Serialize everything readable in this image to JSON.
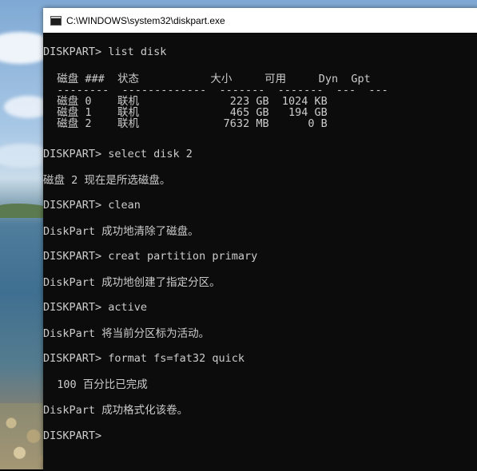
{
  "window": {
    "title": "C:\\WINDOWS\\system32\\diskpart.exe"
  },
  "console": {
    "lines": [
      "DISKPART> list disk",
      "  磁盘 ###  状态           大小     可用     Dyn  Gpt",
      "  --------  -------------  -------  -------  ---  ---",
      "  磁盘 0    联机              223 GB  1024 KB",
      "  磁盘 1    联机              465 GB   194 GB",
      "  磁盘 2    联机             7632 MB      0 B",
      "DISKPART> select disk 2",
      "磁盘 2 现在是所选磁盘。",
      "DISKPART> clean",
      "DiskPart 成功地清除了磁盘。",
      "DISKPART> creat partition primary",
      "DiskPart 成功地创建了指定分区。",
      "DISKPART> active",
      "DiskPart 将当前分区标为活动。",
      "DISKPART> format fs=fat32 quick",
      "  100 百分比已完成",
      "DiskPart 成功格式化该卷。",
      "DISKPART>"
    ]
  }
}
